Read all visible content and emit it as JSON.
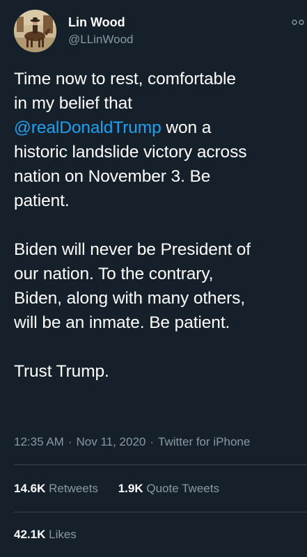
{
  "user": {
    "display_name": "Lin Wood",
    "handle": "@LLinWood",
    "avatar_icon": "profile-avatar-cowboy-on-horse"
  },
  "tweet": {
    "lines": [
      {
        "parts": [
          {
            "text": "Time now to rest, comfortable",
            "type": "text"
          }
        ]
      },
      {
        "parts": [
          {
            "text": "in my belief that",
            "type": "text"
          }
        ]
      },
      {
        "parts": [
          {
            "text": "@realDonaldTrump",
            "type": "mention"
          },
          {
            "text": " won a",
            "type": "text"
          }
        ]
      },
      {
        "parts": [
          {
            "text": "historic landslide victory across",
            "type": "text"
          }
        ]
      },
      {
        "parts": [
          {
            "text": "nation on November 3. Be",
            "type": "text"
          }
        ]
      },
      {
        "parts": [
          {
            "text": "patient.",
            "type": "text"
          }
        ]
      },
      {
        "parts": []
      },
      {
        "parts": [
          {
            "text": "Biden will never be President of",
            "type": "text"
          }
        ]
      },
      {
        "parts": [
          {
            "text": "our nation. To the contrary,",
            "type": "text"
          }
        ]
      },
      {
        "parts": [
          {
            "text": "Biden, along with many others,",
            "type": "text"
          }
        ]
      },
      {
        "parts": [
          {
            "text": "will be an inmate. Be patient.",
            "type": "text"
          }
        ]
      },
      {
        "parts": []
      },
      {
        "parts": [
          {
            "text": "Trust Trump.",
            "type": "text"
          }
        ]
      }
    ]
  },
  "meta": {
    "time": "12:35 AM",
    "date": "Nov 11, 2020",
    "source": "Twitter for iPhone",
    "separator": "·"
  },
  "stats": {
    "retweets_count": "14.6K",
    "retweets_label": "Retweets",
    "quotes_count": "1.9K",
    "quotes_label": "Quote Tweets",
    "likes_count": "42.1K",
    "likes_label": "Likes"
  },
  "colors": {
    "background": "#15202b",
    "text": "#ffffff",
    "secondary": "#8899a6",
    "link": "#1da1f2",
    "divider": "#38444d"
  },
  "icons": {
    "more": "more-options-icon"
  }
}
